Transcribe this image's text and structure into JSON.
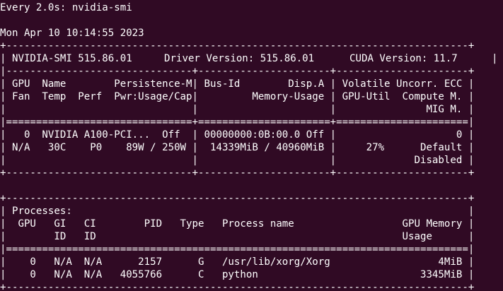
{
  "colors": {
    "background": "#300a24",
    "text": "#ffffff"
  },
  "terminal": {
    "watch_header": "Every 2.0s: nvidia-smi",
    "datetime": "Mon Apr 10 10:14:55 2023",
    "smi": {
      "border_top": "+-----------------------------------------------------------------------------+",
      "version_line": {
        "smi": "| NVIDIA-SMI 515.86.01",
        "driver": "Driver Version: 515.86.01",
        "cuda": "CUDA Version: 11.7",
        "end": "|"
      },
      "header_sep": "|-------------------------------+----------------------+----------------------+",
      "col_headers": [
        "| GPU  Name        Persistence-M| Bus-Id        Disp.A | Volatile Uncorr. ECC |",
        "| Fan  Temp  Perf  Pwr:Usage/Cap|         Memory-Usage | GPU-Util  Compute M. |",
        "|                               |                      |               MIG M. |"
      ],
      "double_sep": "|===============================+======================+======================|",
      "gpu": {
        "index": "0",
        "name": "NVIDIA A100-PCI...",
        "persistence": "Off",
        "bus_id": "00000000:0B:00.0",
        "disp": "Off",
        "ecc": "0",
        "fan": "N/A",
        "temp": "30C",
        "perf": "P0",
        "power_usage": "89W",
        "power_cap": "250W",
        "memory_used": "14339MiB",
        "memory_total": "40960MiB",
        "gpu_util": "27%",
        "compute_mode": "Default",
        "mig_mode": "Disabled"
      },
      "gpu_rows": [
        "|   0  NVIDIA A100-PCI...  Off  | 00000000:0B:00.0 Off |                    0 |",
        "| N/A   30C    P0    89W / 250W |  14339MiB / 40960MiB |     27%      Default |",
        "|                               |                      |             Disabled |"
      ],
      "border_bottom": "+-------------------------------+----------------------+----------------------+",
      "proc_border_top": "+-----------------------------------------------------------------------------+",
      "proc_header": [
        "| Processes:                                                                  |",
        "|  GPU   GI   CI        PID   Type   Process name                  GPU Memory |",
        "|        ID   ID                                                   Usage      |"
      ],
      "proc_sep": "|=============================================================================|",
      "processes": [
        {
          "gpu": "0",
          "gi": "N/A",
          "ci": "N/A",
          "pid": "2157",
          "type": "G",
          "name": "/usr/lib/xorg/Xorg",
          "memory": "4MiB"
        },
        {
          "gpu": "0",
          "gi": "N/A",
          "ci": "N/A",
          "pid": "4055766",
          "type": "C",
          "name": "python",
          "memory": "3345MiB"
        }
      ],
      "process_rows": [
        "|    0   N/A  N/A      2157      G   /usr/lib/xorg/Xorg                  4MiB |",
        "|    0   N/A  N/A   4055766      C   python                           3345MiB |"
      ],
      "proc_border_bottom": "+-----------------------------------------------------------------------------+"
    }
  }
}
